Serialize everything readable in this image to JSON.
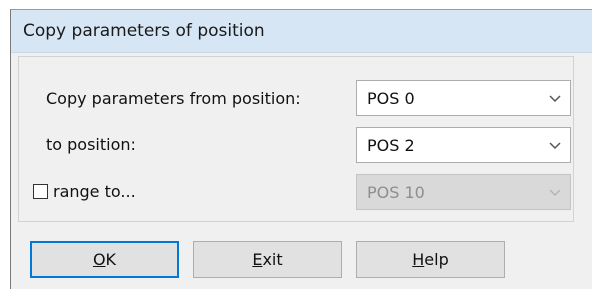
{
  "dialog": {
    "title": "Copy parameters of position"
  },
  "form": {
    "from_label": "Copy parameters from position:",
    "from_value": "POS 0",
    "to_label": "to position:",
    "to_value": "POS 2",
    "range_label": "range to...",
    "range_checked": false,
    "range_value": "POS 10"
  },
  "buttons": {
    "ok": {
      "mnemonic": "O",
      "rest": "K"
    },
    "exit": {
      "mnemonic": "E",
      "rest": "xit"
    },
    "help": {
      "mnemonic": "H",
      "rest": "elp"
    }
  },
  "icons": {
    "dropdown": "chevron-down-icon"
  },
  "colors": {
    "titlebar": "#d6e6f5",
    "default_button_border": "#0078d7",
    "disabled_combo": "#d9d9d9"
  }
}
